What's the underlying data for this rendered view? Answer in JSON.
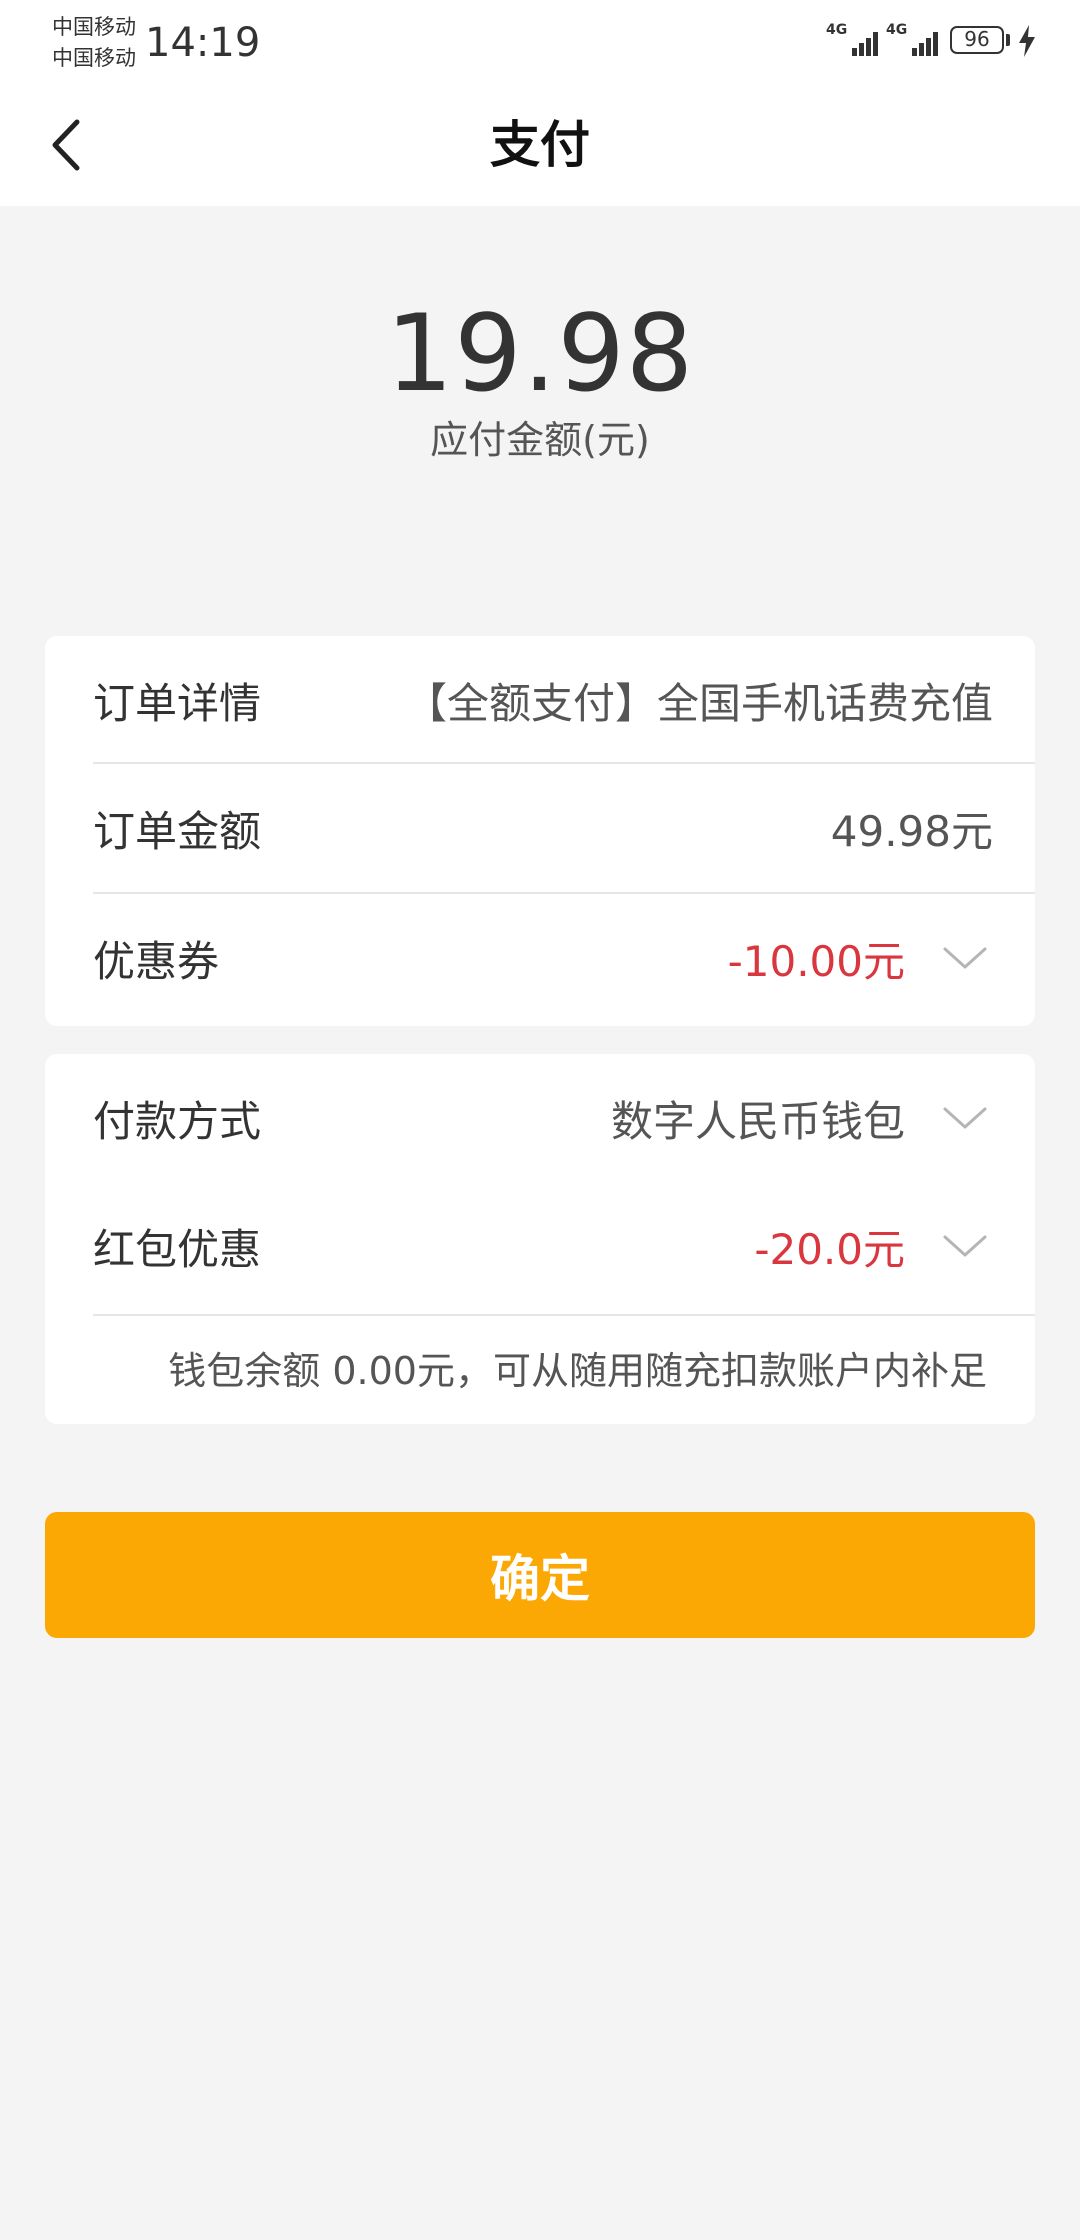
{
  "status_bar": {
    "carrier_1": "中国移动",
    "carrier_2": "中国移动",
    "time": "14:19",
    "network_1": "4G",
    "network_2": "4G",
    "battery": "96",
    "icons": [
      "signal-icon",
      "signal-icon",
      "battery-icon",
      "charging-icon"
    ]
  },
  "header": {
    "title": "支付",
    "back_icon": "chevron-left-icon"
  },
  "summary": {
    "amount": "19.98",
    "label": "应付金额(元)"
  },
  "order_card": {
    "rows": [
      {
        "label": "订单详情",
        "value": "【全额支付】全国手机话费充值"
      },
      {
        "label": "订单金额",
        "value": "49.98元"
      },
      {
        "label": "优惠券",
        "value": "-10.00元"
      }
    ]
  },
  "payment_card": {
    "rows": [
      {
        "label": "付款方式",
        "value": "数字人民币钱包"
      },
      {
        "label": "红包优惠",
        "value": "-20.0元"
      }
    ],
    "note": "钱包余额  0.00元，可从随用随充扣款账户内补足"
  },
  "confirm_button": {
    "label": "确定"
  },
  "colors": {
    "accent": "#fba704",
    "discount": "#d9363e",
    "background": "#f4f4f4"
  }
}
